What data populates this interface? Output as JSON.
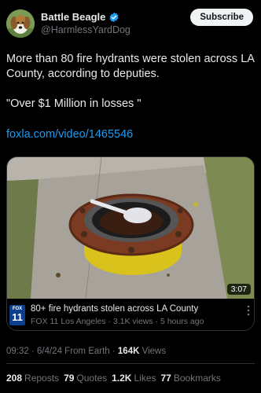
{
  "author": {
    "display_name": "Battle Beagle",
    "handle": "@HarmlessYardDog",
    "verified": true,
    "subscribe_label": "Subscribe"
  },
  "tweet": {
    "line1": "More than 80 fire hydrants were stolen across LA County, according to deputies.",
    "line2": "\"Over $1 Million in losses \"",
    "link": "foxla.com/video/1465546"
  },
  "media": {
    "duration": "3:07",
    "source_logo_top": "FOX",
    "source_logo_num": "11",
    "title": "80+ fire hydrants stolen across LA County",
    "meta": "FOX 11 Los Angeles · 3.1K views · 5 hours ago"
  },
  "post_meta": {
    "time_date_source": "09:32 · 6/4/24 From Earth · ",
    "views_count": "164K",
    "views_label": " Views"
  },
  "stats": {
    "reposts_count": "208",
    "reposts_label": "Reposts",
    "quotes_count": "79",
    "quotes_label": "Quotes",
    "likes_count": "1.2K",
    "likes_label": "Likes",
    "bookmarks_count": "77",
    "bookmarks_label": "Bookmarks"
  },
  "colors": {
    "background": "#000000",
    "text_primary": "#e7e9ea",
    "text_secondary": "#71767b",
    "link": "#1d9bf0",
    "verified": "#1d9bf0"
  }
}
